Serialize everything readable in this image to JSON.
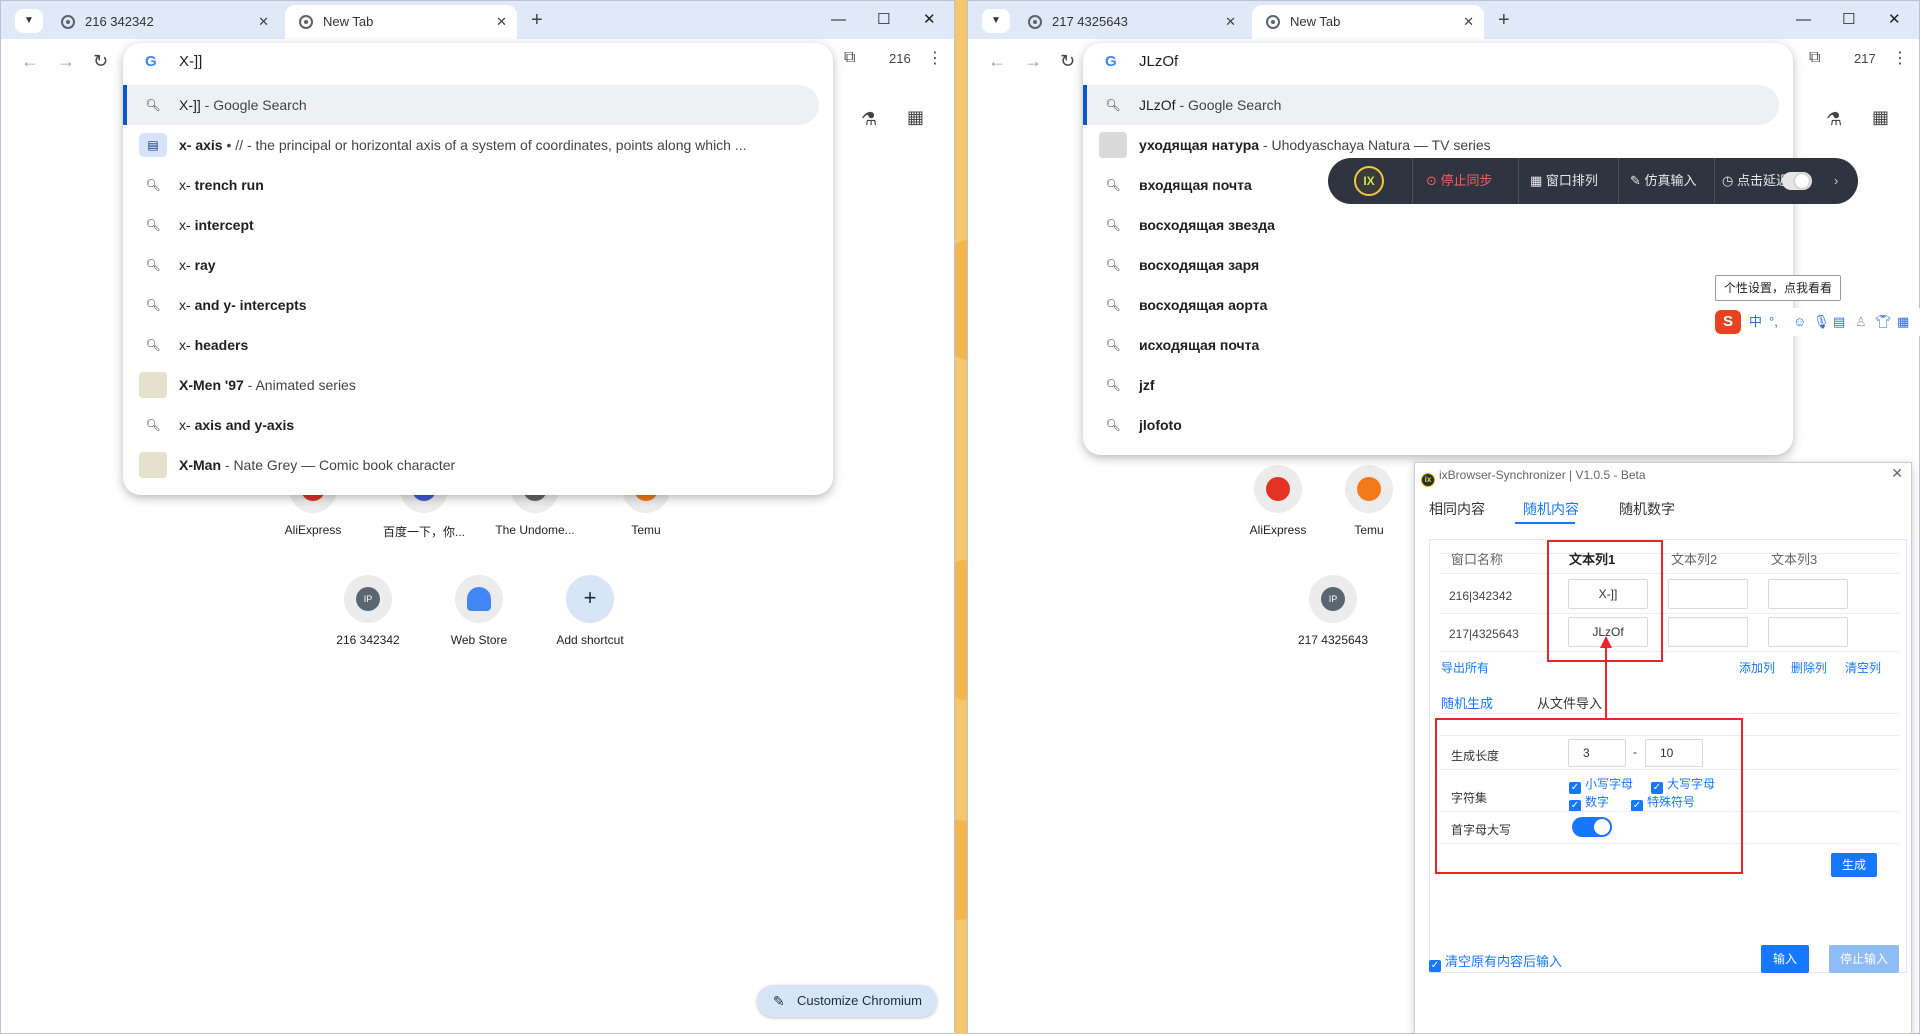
{
  "left_window": {
    "tabs": [
      {
        "title": "216 342342",
        "active": false
      },
      {
        "title": "New Tab",
        "active": true
      }
    ],
    "profile_badge": "216",
    "omnibox": {
      "typed": "X-]]",
      "suggestions": [
        {
          "kind": "search",
          "bold": "X-]]",
          "rest": " - Google Search",
          "selected": true
        },
        {
          "kind": "definition",
          "bold": "x- axis",
          "rest": " • // - the principal or horizontal axis of a system of coordinates, points along which ..."
        },
        {
          "kind": "search",
          "bold": "trench run",
          "prefix": "x- "
        },
        {
          "kind": "search",
          "bold": "intercept",
          "prefix": "x- "
        },
        {
          "kind": "search",
          "bold": "ray",
          "prefix": "x- "
        },
        {
          "kind": "search",
          "bold": "and y- intercepts",
          "prefix": "x- "
        },
        {
          "kind": "search",
          "bold": "headers",
          "prefix": "x- "
        },
        {
          "kind": "entity",
          "bold": "X-Men '97",
          "rest": " - Animated series"
        },
        {
          "kind": "search",
          "bold": "axis and y-axis",
          "prefix": "x- "
        },
        {
          "kind": "entity",
          "bold": "X-Man",
          "rest": " - Nate Grey — Comic book character"
        }
      ]
    },
    "shortcuts_row1": [
      "AliExpress",
      "百度一下，你...",
      "The Undome...",
      "Temu"
    ],
    "shortcuts_row2": [
      "216 342342",
      "Web Store",
      "Add shortcut"
    ],
    "customize_label": "Customize Chromium"
  },
  "right_window": {
    "tabs": [
      {
        "title": "217 4325643",
        "active": false
      },
      {
        "title": "New Tab",
        "active": true
      }
    ],
    "profile_badge": "217",
    "omnibox": {
      "typed": "JLzOf",
      "suggestions": [
        {
          "kind": "search",
          "bold": "JLzOf",
          "rest": " - Google Search",
          "selected": true
        },
        {
          "kind": "entity",
          "bold": "уходящая натура",
          "rest": " - Uhodyaschaya Natura — TV series"
        },
        {
          "kind": "search",
          "bold": "входящая почта"
        },
        {
          "kind": "search",
          "bold": "восходящая звезда"
        },
        {
          "kind": "search",
          "bold": "восходящая заря"
        },
        {
          "kind": "search",
          "bold": "восходящая аорта"
        },
        {
          "kind": "search",
          "bold": "исходящая почта"
        },
        {
          "kind": "search",
          "bold": "jzf"
        },
        {
          "kind": "search",
          "bold": "jlofoto"
        }
      ]
    },
    "shortcuts_row1": [
      "AliExpress",
      "Temu"
    ],
    "shortcuts_row2": [
      "217 4325643"
    ]
  },
  "ix_toolbar": {
    "logo": "IX",
    "stop_sync": "停止同步",
    "window_arrange": "窗口排列",
    "sim_input": "仿真输入",
    "click_delay": "点击延迟"
  },
  "ime": {
    "tooltip": "个性设置，点我看看",
    "logo": "S",
    "mode": "中"
  },
  "dialog": {
    "title": "ixBrowser-Synchronizer | V1.0.5 - Beta",
    "tabs": [
      "相同内容",
      "随机内容",
      "随机数字"
    ],
    "active_tab": "随机内容",
    "columns": [
      "窗口名称",
      "文本列1",
      "文本列2",
      "文本列3"
    ],
    "rows": [
      {
        "name": "216|342342",
        "col1": "X-]]",
        "col2": "",
        "col3": ""
      },
      {
        "name": "217|4325643",
        "col1": "JLzOf",
        "col2": "",
        "col3": ""
      }
    ],
    "export_all": "导出所有",
    "add_col": "添加列",
    "del_col": "删除列",
    "clear_col": "清空列",
    "gen_tabs": [
      "随机生成",
      "从文件导入"
    ],
    "length_label": "生成长度",
    "length_min": "3",
    "length_max": "10",
    "range_dash": "-",
    "charset_label": "字符集",
    "charset": {
      "lower": "小写字母",
      "upper": "大写字母",
      "digits": "数字",
      "special": "特殊符号"
    },
    "capitalize_label": "首字母大写",
    "capitalize_on": true,
    "generate_btn": "生成",
    "clear_before_input": "清空原有内容后输入",
    "input_btn": "输入",
    "stop_input_btn": "停止输入"
  },
  "colors": {
    "accent": "#1677ff",
    "highlight_box": "#e8262a",
    "chrome_tab_strip": "#dfe9f8"
  }
}
